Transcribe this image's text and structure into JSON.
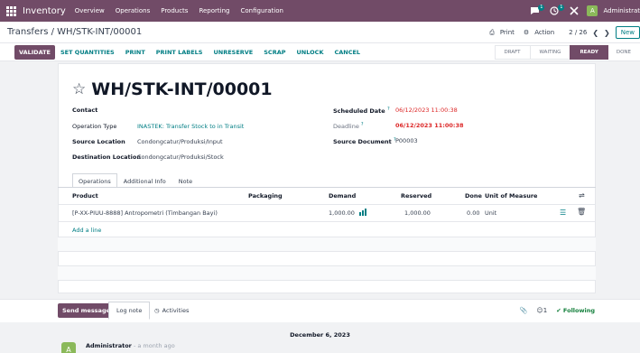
{
  "topnav": {
    "brand": "Inventory",
    "menu": [
      "Overview",
      "Operations",
      "Products",
      "Reporting",
      "Configuration"
    ],
    "chat_badge": "1",
    "activity_badge": "1",
    "avatar_letter": "A",
    "user": "Administrat",
    "accent": "#714B67"
  },
  "control": {
    "breadcrumb_parent": "Transfers",
    "breadcrumb_sep": " / ",
    "breadcrumb_current": "WH/STK-INT/00001",
    "print": "Print",
    "action": "Action",
    "pager": "2 / 26",
    "new": "New"
  },
  "buttons": {
    "validate": "VALIDATE",
    "set_quantities": "SET QUANTITIES",
    "print": "PRINT",
    "print_labels": "PRINT LABELS",
    "unreserve": "UNRESERVE",
    "scrap": "SCRAP",
    "unlock": "UNLOCK",
    "cancel": "CANCEL"
  },
  "status": [
    "DRAFT",
    "WAITING",
    "READY",
    "DONE"
  ],
  "status_active": "READY",
  "record": {
    "name": "WH/STK-INT/00001",
    "contact_label": "Contact",
    "contact_value": "",
    "op_type_label": "Operation Type",
    "op_type_value": "INASTEK: Transfer Stock to in Transit",
    "src_label": "Source Location",
    "src_value": "Condongcatur/Produksi/Input",
    "dst_label": "Destination Location",
    "dst_value": "Condongcatur/Produksi/Stock",
    "sched_label": "Scheduled Date",
    "sched_value": "06/12/2023 11:00:38",
    "deadline_label": "Deadline",
    "deadline_value": "06/12/2023 11:00:38",
    "srcdoc_label": "Source Document",
    "srcdoc_value": "P00003",
    "help_mark": "?"
  },
  "tabs": [
    "Operations",
    "Additional Info",
    "Note"
  ],
  "table": {
    "headers": {
      "product": "Product",
      "packaging": "Packaging",
      "demand": "Demand",
      "reserved": "Reserved",
      "done": "Done",
      "uom": "Unit of Measure"
    },
    "rows": [
      {
        "product": "[P-XX-PIUU-8888] Antropometri (Timbangan Bayi)",
        "packaging": "",
        "demand": "1,000.00",
        "reserved": "1,000.00",
        "done": "0.00",
        "uom": "Unit"
      }
    ],
    "add_line": "Add a line"
  },
  "chatter": {
    "send_message": "Send message",
    "log_note": "Log note",
    "activities": "Activities",
    "followers": "1",
    "following": "Following",
    "date": "December 6, 2023",
    "author": "Administrator",
    "ago": " - a month ago",
    "author_letter": "A"
  }
}
